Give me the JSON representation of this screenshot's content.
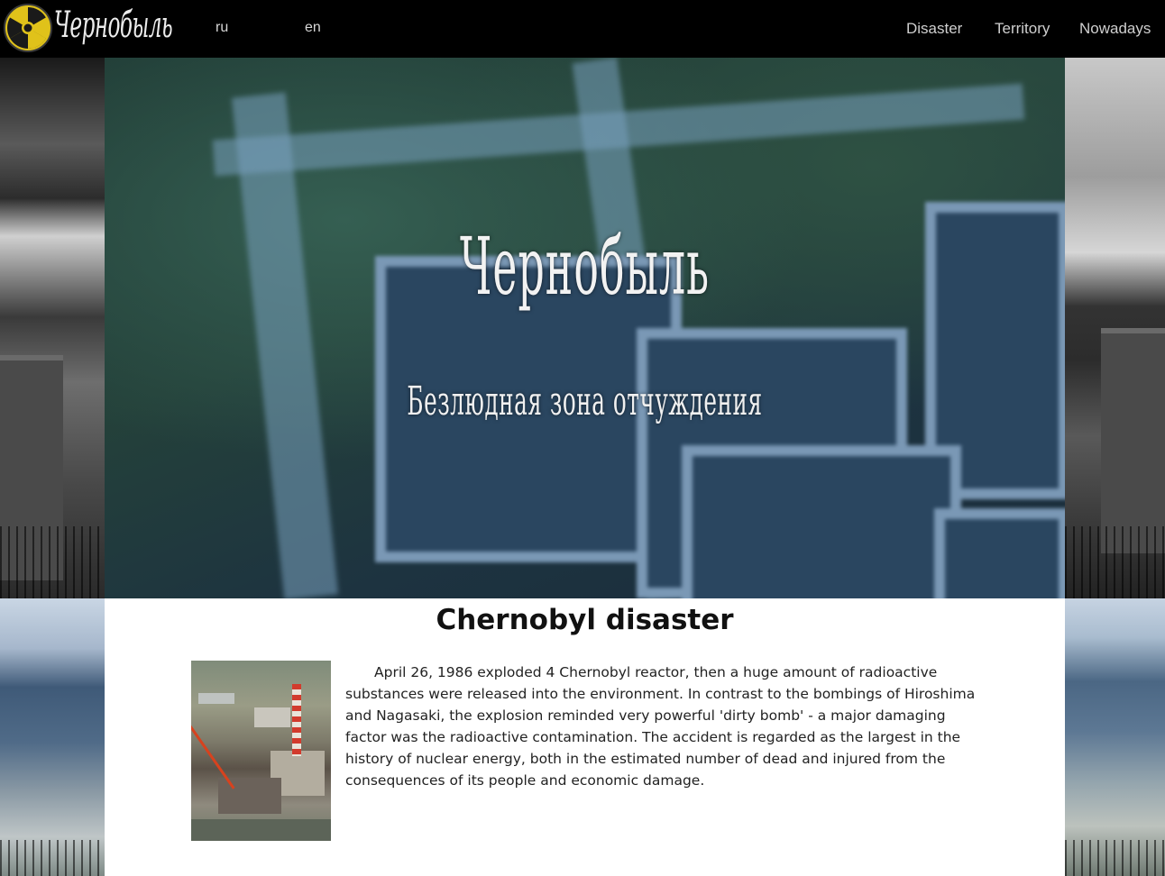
{
  "header": {
    "logo_text": "Чернобыль",
    "languages": [
      {
        "label": "ru"
      },
      {
        "label": "en"
      }
    ],
    "nav": [
      {
        "label": "Disaster"
      },
      {
        "label": "Territory"
      },
      {
        "label": "Nowadays"
      }
    ],
    "logo_icon": "radiation-icon"
  },
  "hero": {
    "title": "Чернобыль",
    "subtitle": "Безлюдная зона отчуждения"
  },
  "article": {
    "title": "Chernobyl disaster",
    "text": "April 26, 1986 exploded 4 Chernobyl reactor, then a huge amount of radioactive substances were released into the environment. In contrast to the bombings of Hiroshima and Nagasaki, the explosion reminded very powerful 'dirty bomb' - a major damaging factor was the radioactive contamination. The accident is regarded as the largest in the history of nuclear energy, both in the estimated number of dead and injured from the consequences of its people and economic damage."
  },
  "colors": {
    "topbar": "#000000",
    "radiation_yellow": "#e0c21a",
    "content_bg": "#ffffff"
  }
}
